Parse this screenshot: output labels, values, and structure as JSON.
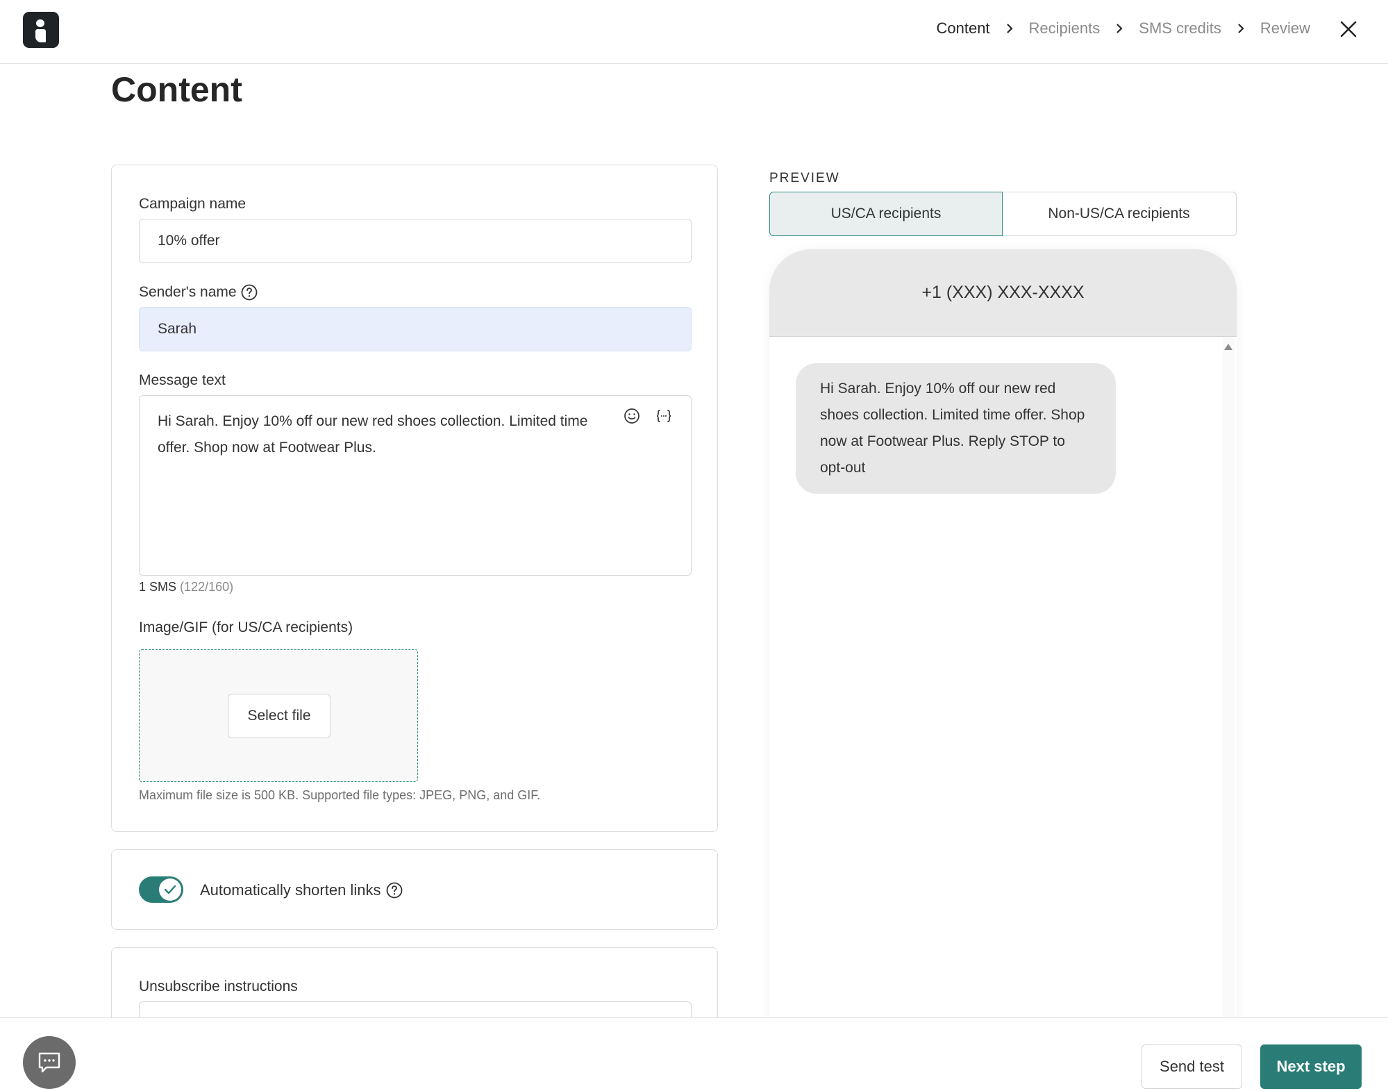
{
  "header": {
    "steps": [
      {
        "label": "Content",
        "active": true
      },
      {
        "label": "Recipients",
        "active": false
      },
      {
        "label": "SMS credits",
        "active": false
      },
      {
        "label": "Review",
        "active": false
      }
    ],
    "close_icon": "close-icon",
    "logo_icon": "info-logo-icon"
  },
  "page": {
    "title": "Content"
  },
  "form": {
    "campaign_name": {
      "label": "Campaign name",
      "value": "10% offer"
    },
    "sender_name": {
      "label": "Sender's name",
      "value": "Sarah",
      "help_icon": "question-circle-icon"
    },
    "message": {
      "label": "Message text",
      "value": "Hi Sarah. Enjoy 10% off our new red shoes collection. Limited time offer. Shop now at Footwear Plus.",
      "emoji_icon": "emoji-icon",
      "variable_icon": "variable-braces-icon",
      "sms_count": "1 SMS",
      "char_count": "(122/160)"
    },
    "image": {
      "label": "Image/GIF (for US/CA recipients)",
      "select_label": "Select file",
      "hint": "Maximum file size is 500 KB. Supported file types: JPEG, PNG, and GIF."
    },
    "shorten_links": {
      "label": "Automatically shorten links",
      "enabled": true
    },
    "unsubscribe": {
      "label": "Unsubscribe instructions"
    }
  },
  "preview": {
    "label": "PREVIEW",
    "tabs": [
      {
        "label": "US/CA recipients",
        "selected": true
      },
      {
        "label": "Non-US/CA recipients",
        "selected": false
      }
    ],
    "phone_number": "+1 (XXX) XXX-XXXX",
    "bubble_text": "Hi Sarah. Enjoy 10% off our new red shoes collection. Limited time offer. Shop now at Footwear Plus. Reply STOP to opt-out"
  },
  "footer": {
    "send_test_label": "Send test",
    "next_label": "Next step",
    "chat_icon": "chat-icon"
  },
  "colors": {
    "accent": "#2a7d76",
    "sender_field_bg": "#e8eefc",
    "bubble_bg": "#e7e7e7",
    "phone_header_bg": "#e8e8e8"
  }
}
